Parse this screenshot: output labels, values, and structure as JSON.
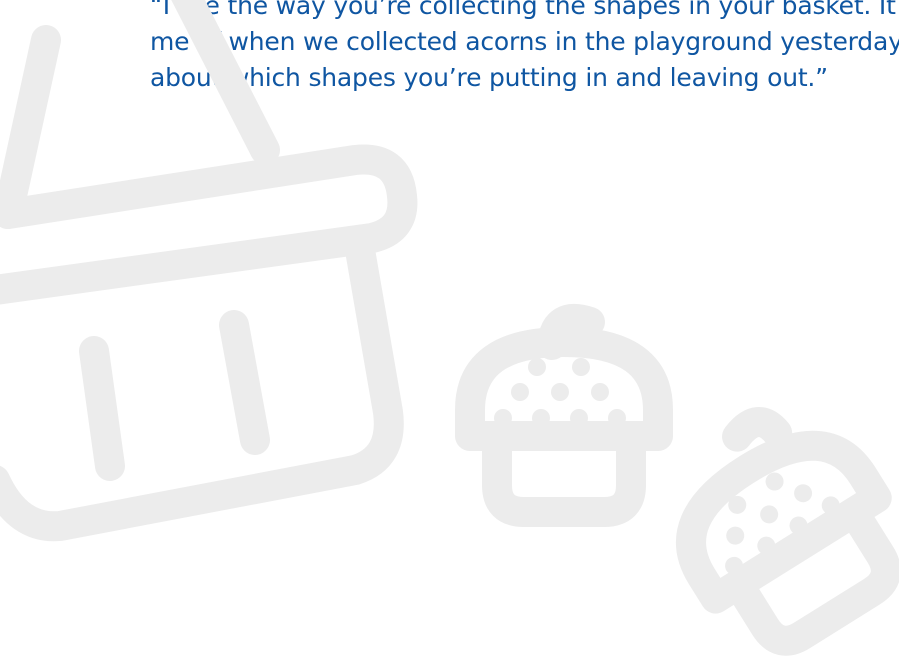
{
  "quote": {
    "lines": [
      "“I like the way you’re collecting the shapes in your basket. It reminds",
      "me of when we collected acorns in the playground yesterday. Tell me",
      "about which shapes you’re putting in and leaving out.”"
    ]
  },
  "illustration": {
    "icons": [
      "basket-icon",
      "acorn-icon",
      "acorn-icon"
    ],
    "color": "#ececec",
    "text_color": "#0f56a2"
  }
}
